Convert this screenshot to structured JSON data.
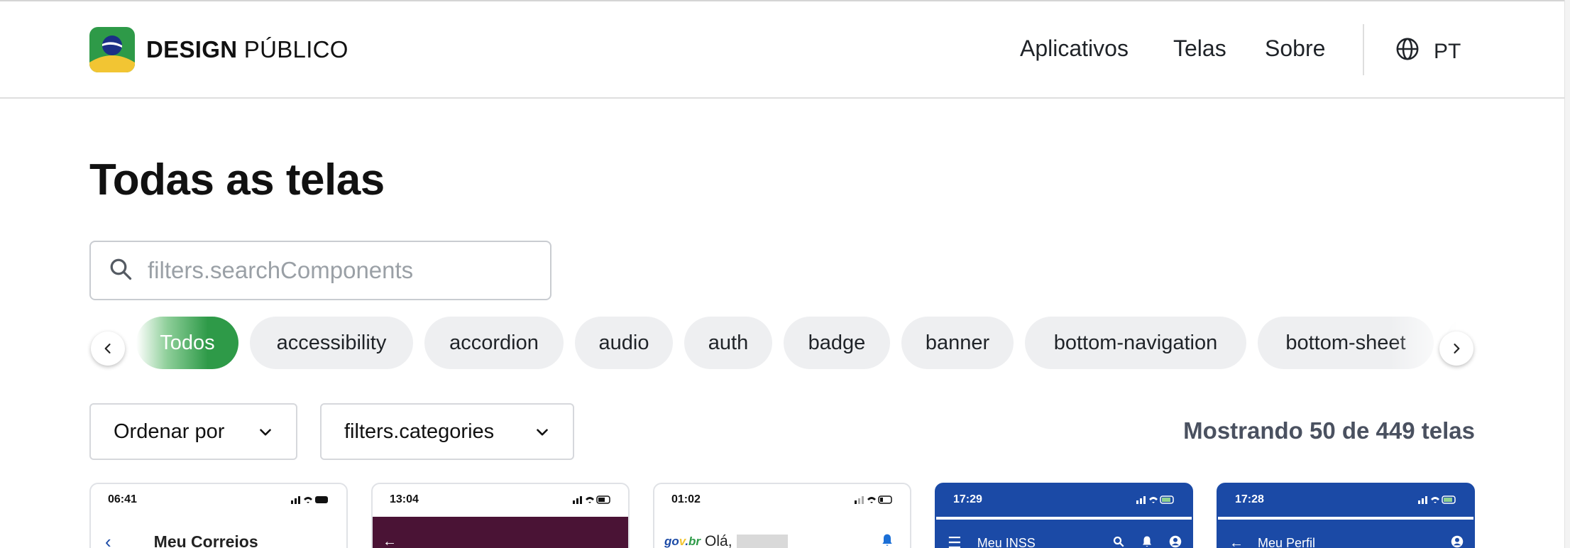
{
  "header": {
    "brand_bold": "DESIGN",
    "brand_regular": "PÚBLICO",
    "nav": [
      "Aplicativos",
      "Telas",
      "Sobre"
    ],
    "language": "PT"
  },
  "page": {
    "title": "Todas as telas"
  },
  "search": {
    "placeholder": "filters.searchComponents"
  },
  "chips": [
    "Todos",
    "accessibility",
    "accordion",
    "audio",
    "auth",
    "badge",
    "banner",
    "bottom-navigation",
    "bottom-sheet"
  ],
  "chips_active": "Todos",
  "filters": {
    "sort_label": "Ordenar por",
    "categories_label": "filters.categories",
    "result_count": "Mostrando 50 de 449 telas"
  },
  "cards": [
    {
      "time": "06:41",
      "title": "Meu Correios",
      "theme": "light"
    },
    {
      "time": "13:04",
      "title": "",
      "theme": "dark-purple"
    },
    {
      "time": "01:02",
      "title": "Olá,",
      "theme": "light"
    },
    {
      "time": "17:29",
      "title": "Meu INSS",
      "theme": "blue"
    },
    {
      "time": "17:28",
      "title": "Meu Perfil",
      "theme": "blue"
    }
  ],
  "colors": {
    "accent_green": "#2e9a48",
    "gov_blue": "#1b4aa6",
    "chip_bg": "#eeeff1"
  },
  "icons": {
    "search": "search-icon",
    "globe": "globe-icon",
    "chevron_left": "chevron-left-icon",
    "chevron_right": "chevron-right-icon",
    "chevron_down": "chevron-down-icon"
  }
}
